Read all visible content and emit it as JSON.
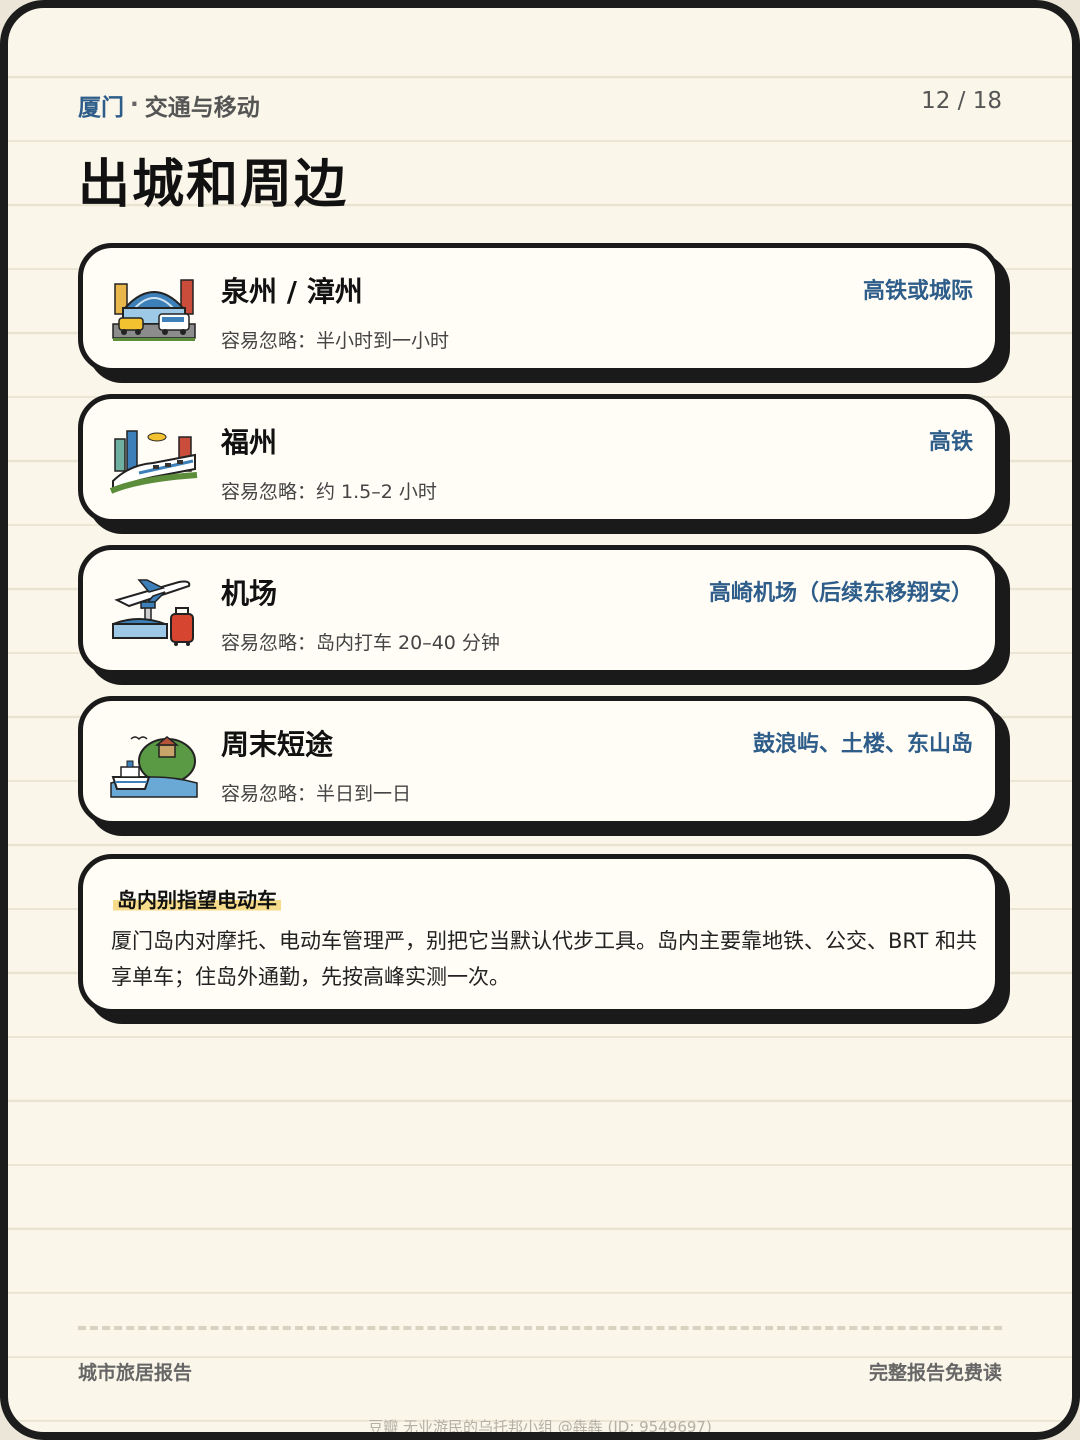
{
  "header": {
    "city": "厦门",
    "separator": "·",
    "section": "交通与移动",
    "page_indicator": "12 / 18"
  },
  "title": "出城和周边",
  "destinations": [
    {
      "name": "泉州 / 漳州",
      "time": "容易忽略：半小时到一小时",
      "mode": "高铁或城际",
      "icon": "station-icon"
    },
    {
      "name": "福州",
      "time": "容易忽略：约 1.5–2 小时",
      "mode": "高铁",
      "icon": "high-speed-train-icon"
    },
    {
      "name": "机场",
      "time": "容易忽略：岛内打车 20–40 分钟",
      "mode": "高崎机场（后续东移翔安）",
      "icon": "airport-icon"
    },
    {
      "name": "周末短途",
      "time": "容易忽略：半日到一日",
      "mode": "鼓浪屿、土楼、东山岛",
      "icon": "ferry-island-icon"
    }
  ],
  "tip": {
    "heading": "岛内别指望电动车",
    "body": "厦门岛内对摩托、电动车管理严，别把它当默认代步工具。岛内主要靠地铁、公交、BRT 和共享单车；住岛外通勤，先按高峰实测一次。"
  },
  "footer": {
    "left": "城市旅居报告",
    "right": "完整报告免费读"
  },
  "watermark": "豆瓣  无业游民的乌托邦小组 @犇犇 (ID: 9549697)",
  "colors": {
    "accent_blue": "#2e5d8a",
    "paper": "#faf6e9",
    "border": "#1a1a1a",
    "highlight": "#f6dc8a"
  }
}
